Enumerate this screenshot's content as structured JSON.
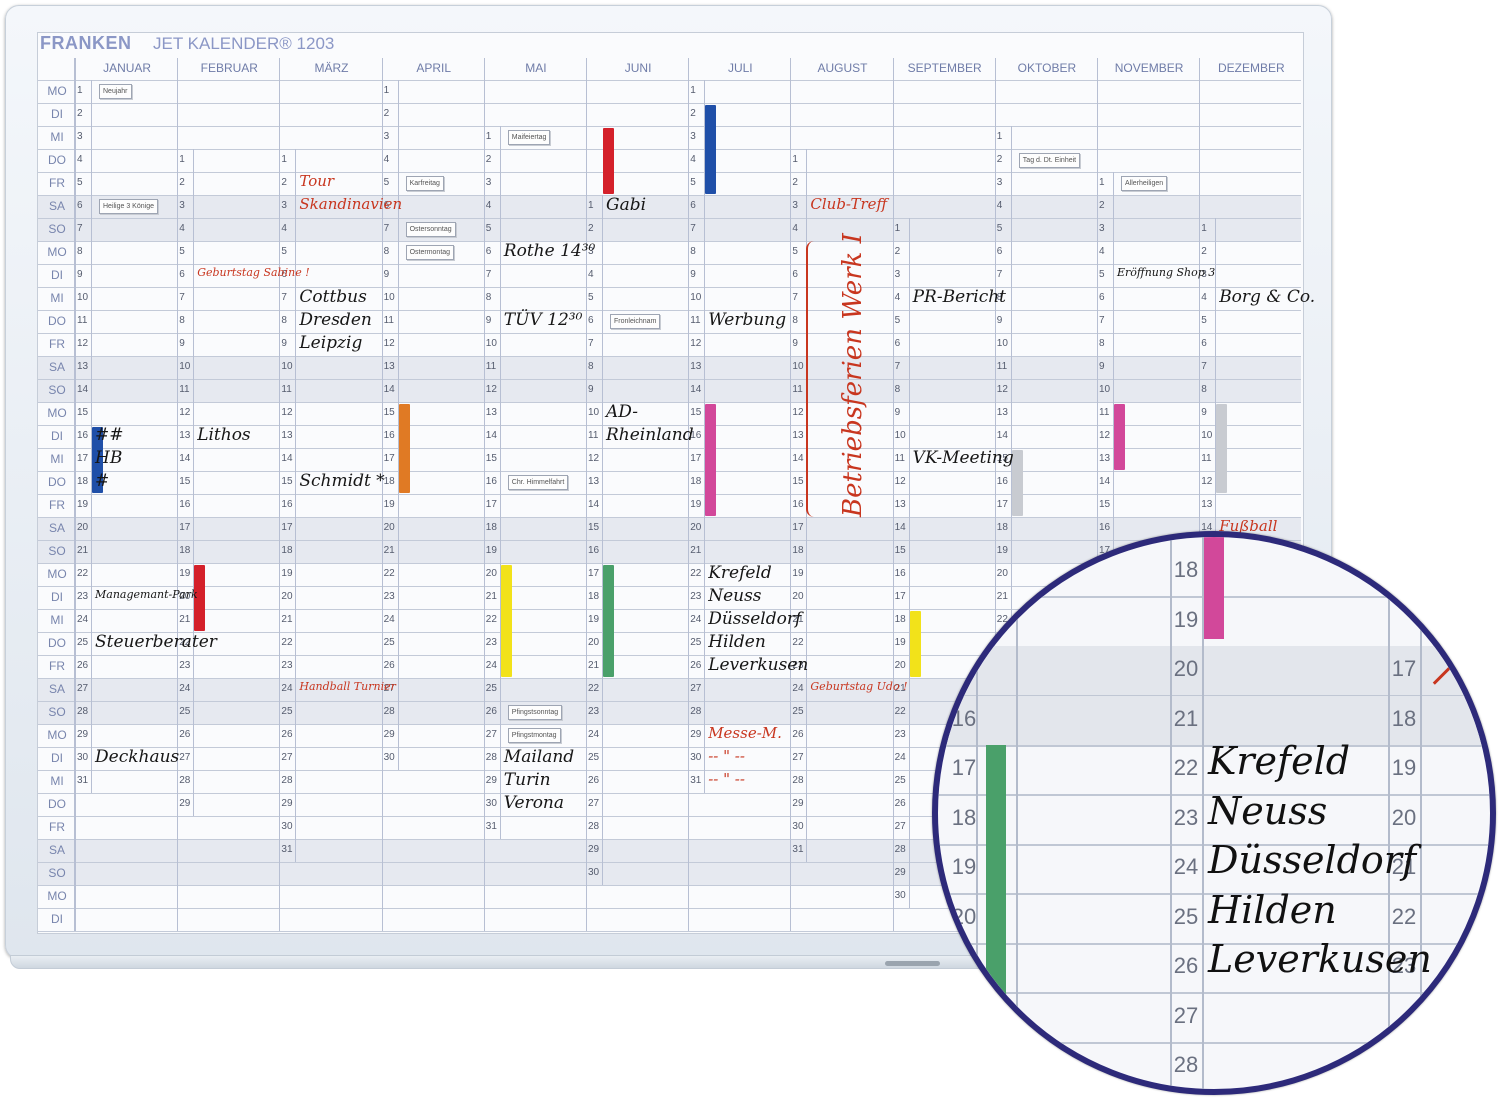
{
  "brand": "FRANKEN",
  "product": "JET KALENDER® 1203",
  "months": [
    "JANUAR",
    "FEBRUAR",
    "MÄRZ",
    "APRIL",
    "MAI",
    "JUNI",
    "JULI",
    "AUGUST",
    "SEPTEMBER",
    "OKTOBER",
    "NOVEMBER",
    "DEZEMBER"
  ],
  "weekdays": [
    "MO",
    "DI",
    "MI",
    "DO",
    "FR",
    "SA",
    "SO",
    "MO",
    "DI",
    "MI",
    "DO",
    "FR",
    "SA",
    "SO",
    "MO",
    "DI",
    "MI",
    "DO",
    "FR",
    "SA",
    "SO",
    "MO",
    "DI",
    "MI",
    "DO",
    "FR",
    "SA",
    "SO",
    "MO",
    "DI",
    "MI",
    "DO",
    "FR",
    "SA",
    "SO",
    "MO",
    "DI"
  ],
  "month_start_rows": [
    0,
    3,
    3,
    0,
    2,
    5,
    0,
    3,
    6,
    2,
    4,
    6
  ],
  "month_days": [
    31,
    29,
    31,
    30,
    31,
    30,
    31,
    31,
    30,
    31,
    30,
    31
  ],
  "holidays": [
    {
      "text": "Neujahr",
      "m": 0,
      "row": 0
    },
    {
      "text": "Heilige 3 Könige",
      "m": 0,
      "row": 5
    },
    {
      "text": "Karfreitag",
      "m": 3,
      "row": 4
    },
    {
      "text": "Ostersonntag",
      "m": 3,
      "row": 6
    },
    {
      "text": "Ostermontag",
      "m": 3,
      "row": 7
    },
    {
      "text": "Maifeiertag",
      "m": 4,
      "row": 2
    },
    {
      "text": "Chr. Himmelfahrt",
      "m": 4,
      "row": 17
    },
    {
      "text": "Pfingstsonntag",
      "m": 4,
      "row": 27
    },
    {
      "text": "Pfingstmontag",
      "m": 4,
      "row": 28
    },
    {
      "text": "Fronleichnam",
      "m": 5,
      "row": 10
    },
    {
      "text": "Tag d. Dt. Einheit",
      "m": 9,
      "row": 3
    },
    {
      "text": "Allerheiligen",
      "m": 10,
      "row": 4
    }
  ],
  "magnets": [
    {
      "m": 0,
      "row": 15,
      "len": 3,
      "color": "#1f4fa8"
    },
    {
      "m": 1,
      "row": 21,
      "len": 3,
      "color": "#d4202a"
    },
    {
      "m": 3,
      "row": 14,
      "len": 4,
      "color": "#e07a24"
    },
    {
      "m": 4,
      "row": 21,
      "len": 5,
      "color": "#f2e21a"
    },
    {
      "m": 5,
      "row": 2,
      "len": 3,
      "color": "#d4202a"
    },
    {
      "m": 5,
      "row": 21,
      "len": 5,
      "color": "#4aa06a"
    },
    {
      "m": 6,
      "row": 1,
      "len": 4,
      "color": "#1f4fa8"
    },
    {
      "m": 6,
      "row": 14,
      "len": 5,
      "color": "#d2489a"
    },
    {
      "m": 8,
      "row": 23,
      "len": 3,
      "color": "#f2e21a"
    },
    {
      "m": 9,
      "row": 16,
      "len": 3,
      "color": "#c8cbd1"
    },
    {
      "m": 10,
      "row": 14,
      "len": 3,
      "color": "#d2489a"
    },
    {
      "m": 11,
      "row": 14,
      "len": 4,
      "color": "#c8cbd1"
    },
    {
      "m": 11,
      "row": 20,
      "len": 5,
      "color": "#d2489a"
    }
  ],
  "notes": [
    {
      "text": "##",
      "m": 0,
      "row": 15,
      "color": "black"
    },
    {
      "text": "HB",
      "m": 0,
      "row": 16,
      "color": "black"
    },
    {
      "text": "#",
      "m": 0,
      "row": 17,
      "color": "black"
    },
    {
      "text": "Managemant-Park",
      "m": 0,
      "row": 22,
      "color": "black",
      "small": true
    },
    {
      "text": "Steuerberater",
      "m": 0,
      "row": 24,
      "color": "black"
    },
    {
      "text": "Deckhaus",
      "m": 0,
      "row": 29,
      "color": "black"
    },
    {
      "text": "Geburtstag Sabine !",
      "m": 1,
      "row": 8,
      "color": "red",
      "small": true
    },
    {
      "text": "Lithos",
      "m": 1,
      "row": 15,
      "color": "black"
    },
    {
      "text": "Tour",
      "m": 2,
      "row": 4,
      "color": "red"
    },
    {
      "text": "Skandinavien",
      "m": 2,
      "row": 5,
      "color": "red"
    },
    {
      "text": "Cottbus",
      "m": 2,
      "row": 9,
      "color": "black"
    },
    {
      "text": "Dresden",
      "m": 2,
      "row": 10,
      "color": "black"
    },
    {
      "text": "Leipzig",
      "m": 2,
      "row": 11,
      "color": "black"
    },
    {
      "text": "Schmidt *",
      "m": 2,
      "row": 17,
      "color": "black"
    },
    {
      "text": "Handball Turnier",
      "m": 2,
      "row": 26,
      "color": "red",
      "small": true
    },
    {
      "text": "Rothe 14³⁰",
      "m": 4,
      "row": 7,
      "color": "black"
    },
    {
      "text": "TÜV 12³⁰",
      "m": 4,
      "row": 10,
      "color": "black"
    },
    {
      "text": "Mailand",
      "m": 4,
      "row": 29,
      "color": "black"
    },
    {
      "text": "Turin",
      "m": 4,
      "row": 30,
      "color": "black"
    },
    {
      "text": "Verona",
      "m": 4,
      "row": 31,
      "color": "black"
    },
    {
      "text": "Gabi",
      "m": 5,
      "row": 5,
      "color": "black"
    },
    {
      "text": "AD-",
      "m": 5,
      "row": 14,
      "color": "black"
    },
    {
      "text": "Rheinland",
      "m": 5,
      "row": 15,
      "color": "black"
    },
    {
      "text": "Werbung",
      "m": 6,
      "row": 10,
      "color": "black"
    },
    {
      "text": "Krefeld",
      "m": 6,
      "row": 21,
      "color": "black"
    },
    {
      "text": "Neuss",
      "m": 6,
      "row": 22,
      "color": "black"
    },
    {
      "text": "Düsseldorf",
      "m": 6,
      "row": 23,
      "color": "black"
    },
    {
      "text": "Hilden",
      "m": 6,
      "row": 24,
      "color": "black"
    },
    {
      "text": "Leverkusen",
      "m": 6,
      "row": 25,
      "color": "black"
    },
    {
      "text": "Messe-M.",
      "m": 6,
      "row": 28,
      "color": "red"
    },
    {
      "text": "-- \" --",
      "m": 6,
      "row": 29,
      "color": "red"
    },
    {
      "text": "-- \" --",
      "m": 6,
      "row": 30,
      "color": "red"
    },
    {
      "text": "Club-Treff",
      "m": 7,
      "row": 5,
      "color": "red"
    },
    {
      "text": "Geburtstag Udo !",
      "m": 7,
      "row": 26,
      "color": "red",
      "small": true
    },
    {
      "text": "PR-Bericht",
      "m": 8,
      "row": 9,
      "color": "black"
    },
    {
      "text": "VK-Meeting",
      "m": 8,
      "row": 16,
      "color": "black"
    },
    {
      "text": "Eröffnung Shop 3",
      "m": 10,
      "row": 8,
      "color": "black",
      "small": true
    },
    {
      "text": "Borg & Co.",
      "m": 11,
      "row": 9,
      "color": "black"
    },
    {
      "text": "Fußball",
      "m": 11,
      "row": 19,
      "color": "red"
    }
  ],
  "vertical_note": {
    "text": "Betriebsferien Werk I",
    "m": 7,
    "row_from": 7,
    "row_to": 19,
    "color": "red"
  },
  "zoom": {
    "left_nums": [
      "16",
      "17",
      "18",
      "19",
      "20"
    ],
    "mid_nums": [
      "18",
      "19",
      "20",
      "21",
      "22",
      "23",
      "24",
      "25",
      "26",
      "27",
      "28"
    ],
    "right_nums": [
      "17",
      "18",
      "19",
      "20",
      "21",
      "22",
      "23"
    ],
    "notes": [
      "Krefeld",
      "Neuss",
      "Düsseldorf",
      "Hilden",
      "Leverkusen"
    ]
  }
}
